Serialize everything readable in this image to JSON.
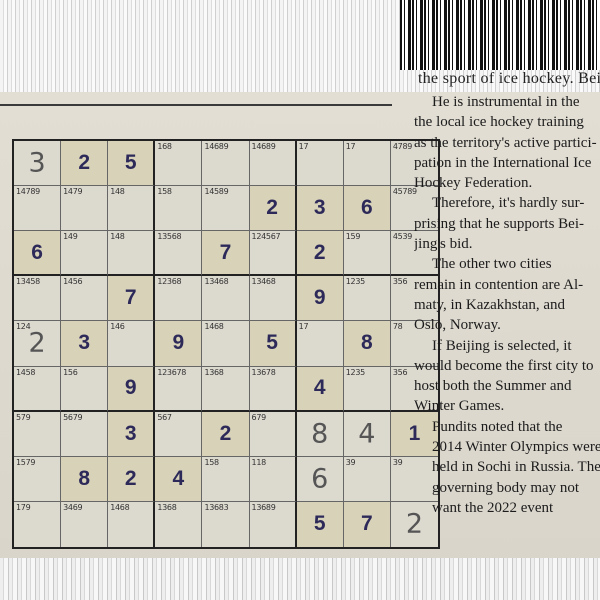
{
  "header_clip": "the sport of ice hockey. Beijing.",
  "sudoku": {
    "rows": [
      [
        {
          "h": "3"
        },
        {
          "g": "2"
        },
        {
          "g": "5"
        },
        {
          "n": "168"
        },
        {
          "n": "14689"
        },
        {
          "n": "14689"
        },
        {
          "n": "17"
        },
        {
          "n": "17"
        },
        {
          "n": "4789"
        }
      ],
      [
        {
          "n": "14789"
        },
        {
          "n": "1479"
        },
        {
          "n": "148"
        },
        {
          "n": "158"
        },
        {
          "n": "14589"
        },
        {
          "g": "2"
        },
        {
          "g": "3"
        },
        {
          "g": "6"
        },
        {
          "n": "45789"
        }
      ],
      [
        {
          "g": "6"
        },
        {
          "n": "149"
        },
        {
          "n": "148"
        },
        {
          "n": "13568"
        },
        {
          "g": "7"
        },
        {
          "n": "124567"
        },
        {
          "g": "2"
        },
        {
          "n": "159"
        },
        {
          "n": "4539"
        }
      ],
      [
        {
          "n": "13458"
        },
        {
          "n": "1456"
        },
        {
          "g": "7"
        },
        {
          "n": "12368"
        },
        {
          "n": "13468"
        },
        {
          "n": "13468"
        },
        {
          "g": "9"
        },
        {
          "n": "1235"
        },
        {
          "n": "356"
        }
      ],
      [
        {
          "n": "124",
          "h": "2"
        },
        {
          "g": "3"
        },
        {
          "n": "146"
        },
        {
          "g": "9"
        },
        {
          "n": "1468"
        },
        {
          "g": "5"
        },
        {
          "n": "17"
        },
        {
          "g": "8"
        },
        {
          "n": "78"
        }
      ],
      [
        {
          "n": "1458"
        },
        {
          "n": "156"
        },
        {
          "g": "9"
        },
        {
          "n": "123678"
        },
        {
          "n": "1368"
        },
        {
          "n": "13678"
        },
        {
          "g": "4"
        },
        {
          "n": "1235"
        },
        {
          "n": "356"
        }
      ],
      [
        {
          "n": "579"
        },
        {
          "n": "5679"
        },
        {
          "g": "3"
        },
        {
          "n": "567"
        },
        {
          "g": "2"
        },
        {
          "n": "679"
        },
        {
          "h": "8"
        },
        {
          "h": "4"
        },
        {
          "g": "1"
        }
      ],
      [
        {
          "n": "1579"
        },
        {
          "g": "8"
        },
        {
          "g": "2"
        },
        {
          "g": "4"
        },
        {
          "n": "158"
        },
        {
          "n": "118"
        },
        {
          "h": "6"
        },
        {
          "n": "39"
        },
        {
          "n": "39"
        }
      ],
      [
        {
          "n": "179"
        },
        {
          "n": "3469"
        },
        {
          "n": "1468"
        },
        {
          "n": "1368"
        },
        {
          "n": "13683"
        },
        {
          "n": "13689"
        },
        {
          "g": "5"
        },
        {
          "g": "7"
        },
        {
          "h": "2"
        }
      ]
    ]
  },
  "article": {
    "lines": [
      {
        "t": "He is instrumental in the",
        "i": true
      },
      {
        "t": "the local ice hockey training",
        "i": false
      },
      {
        "t": "as the territory's active partici-",
        "i": false
      },
      {
        "t": "pation in the International Ice",
        "i": false
      },
      {
        "t": "Hockey Federation.",
        "i": false
      },
      {
        "t": "Therefore, it's hardly sur-",
        "i": true
      },
      {
        "t": "prising that he supports Bei-",
        "i": false
      },
      {
        "t": "jing's bid.",
        "i": false
      },
      {
        "t": "The other two cities",
        "i": true
      },
      {
        "t": "remain in contention are Al-",
        "i": false
      },
      {
        "t": "maty, in Kazakhstan, and",
        "i": false
      },
      {
        "t": "Oslo, Norway.",
        "i": false
      },
      {
        "t": "If Beijing is selected, it",
        "i": true
      },
      {
        "t": "would become the first city to",
        "i": false
      },
      {
        "t": "host both the Summer and",
        "i": false
      },
      {
        "t": "Winter Games.",
        "i": false
      },
      {
        "t": "Pundits noted that the",
        "i": true
      },
      {
        "t": "2014 Winter Olympics were",
        "i": true
      },
      {
        "t": "held in Sochi in Russia. The",
        "i": true
      },
      {
        "t": "governing body may not",
        "i": true
      },
      {
        "t": "want the 2022 event",
        "i": true
      }
    ]
  }
}
